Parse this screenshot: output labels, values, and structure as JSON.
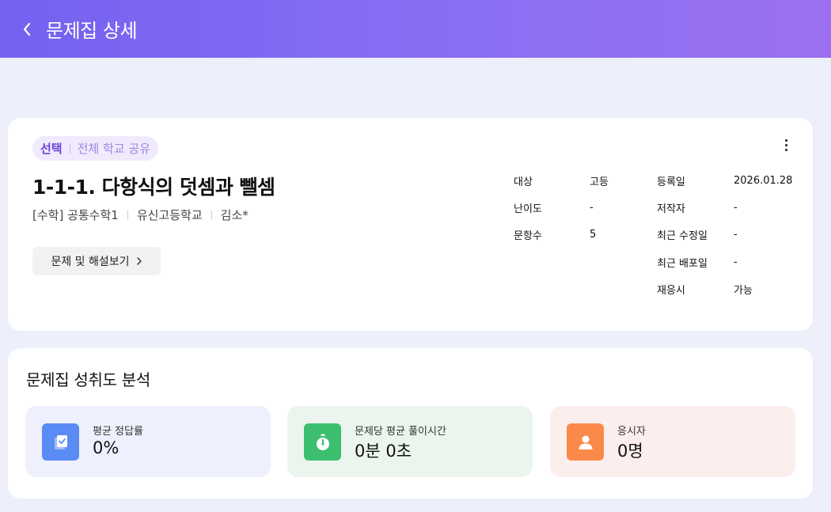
{
  "header": {
    "title": "문제집 상세"
  },
  "set": {
    "tag_primary": "선택",
    "tag_secondary": "전체 학교 공유",
    "title": "1-1-1. 다항식의 덧셈과 뺄셈",
    "subject": "[수학] 공통수학1",
    "school": "유신고등학교",
    "author_short": "김소*",
    "view_button": "문제 및 해설보기"
  },
  "details_left": [
    {
      "label": "대상",
      "value": "고등"
    },
    {
      "label": "난이도",
      "value": "-"
    },
    {
      "label": "문항수",
      "value": "5"
    }
  ],
  "details_right": [
    {
      "label": "등록일",
      "value": "2026.01.28"
    },
    {
      "label": "저작자",
      "value": "-"
    },
    {
      "label": "최근 수정일",
      "value": "-"
    },
    {
      "label": "최근 배포일",
      "value": "-"
    },
    {
      "label": "재응시",
      "value": "가능"
    }
  ],
  "analysis": {
    "title": "문제집 성취도 분석",
    "stats": [
      {
        "label": "평균 정답률",
        "value": "0%",
        "icon": "checklist-icon",
        "color": "#5b8cf5"
      },
      {
        "label": "문제당 평균 풀이시간",
        "value": "0분 0초",
        "icon": "stopwatch-icon",
        "color": "#3cc070"
      },
      {
        "label": "응시자",
        "value": "0명",
        "icon": "person-icon",
        "color": "#fb8a4a"
      }
    ]
  }
}
